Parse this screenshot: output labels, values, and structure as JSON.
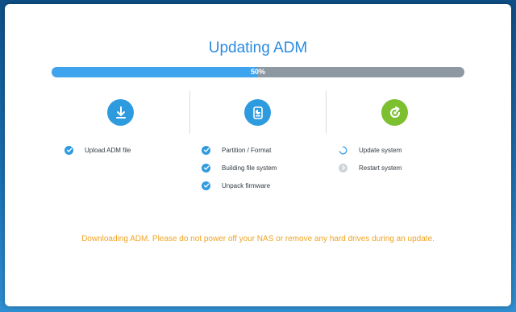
{
  "title": "Updating ADM",
  "progress": {
    "percent": 50,
    "label": "50%"
  },
  "stages": [
    {
      "icon": "download-icon",
      "color": "#2f9bdf"
    },
    {
      "icon": "build-disk-icon",
      "color": "#2f9bdf"
    },
    {
      "icon": "refresh-icon",
      "color": "#7cbf2f"
    }
  ],
  "steps": {
    "upload": {
      "label": "Upload ADM file",
      "status": "done"
    },
    "partition": {
      "label": "Partition / Format",
      "status": "done"
    },
    "building": {
      "label": "Building file system",
      "status": "done"
    },
    "unpack": {
      "label": "Unpack firmware",
      "status": "done"
    },
    "update": {
      "label": "Update system",
      "status": "in-progress"
    },
    "restart": {
      "label": "Restart system",
      "status": "pending"
    }
  },
  "notice": "Downloading ADM. Please do not power off your NAS or remove any hard drives during an update.",
  "colors": {
    "accent": "#2a8be0",
    "check": "#2f9bdf",
    "pending": "#cfd4d8",
    "warning": "#f0a323",
    "success": "#7cbf2f"
  }
}
